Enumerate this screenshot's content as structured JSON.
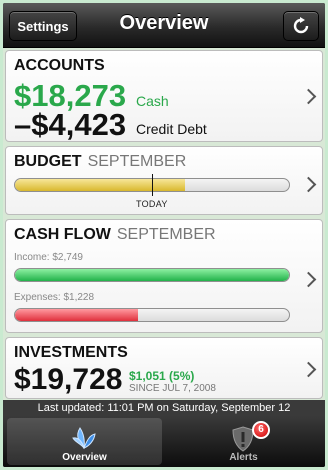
{
  "navbar": {
    "title": "Overview",
    "settings_label": "Settings",
    "refresh_icon": "refresh-icon"
  },
  "accounts": {
    "heading": "ACCOUNTS",
    "cash_amount": "$18,273",
    "cash_label": "Cash",
    "debt_amount": "–$4,423",
    "debt_label": "Credit Debt"
  },
  "budget": {
    "heading": "BUDGET",
    "period": "SEPTEMBER",
    "today_label": "TODAY",
    "spent_fraction": 0.62,
    "today_fraction": 0.5
  },
  "cash_flow": {
    "heading": "CASH FLOW",
    "period": "SEPTEMBER",
    "income_label": "Income: $2,749",
    "expenses_label": "Expenses: $1,228",
    "income_fraction": 1.0,
    "expenses_fraction": 0.45
  },
  "investments": {
    "heading": "INVESTMENTS",
    "value": "$19,728",
    "gain": "$1,051 (5%)",
    "since": "SINCE JUL 7, 2008"
  },
  "status": {
    "last_updated": "Last updated: 11:01 PM on Saturday, September 12"
  },
  "tabs": [
    {
      "label": "Overview",
      "icon": "overview-leaf-icon",
      "selected": true
    },
    {
      "label": "Alerts",
      "icon": "alerts-shield-icon",
      "badge": "6"
    }
  ],
  "colors": {
    "green": "#2aa84b",
    "red": "#e0303c",
    "yellow": "#d9b82e"
  }
}
